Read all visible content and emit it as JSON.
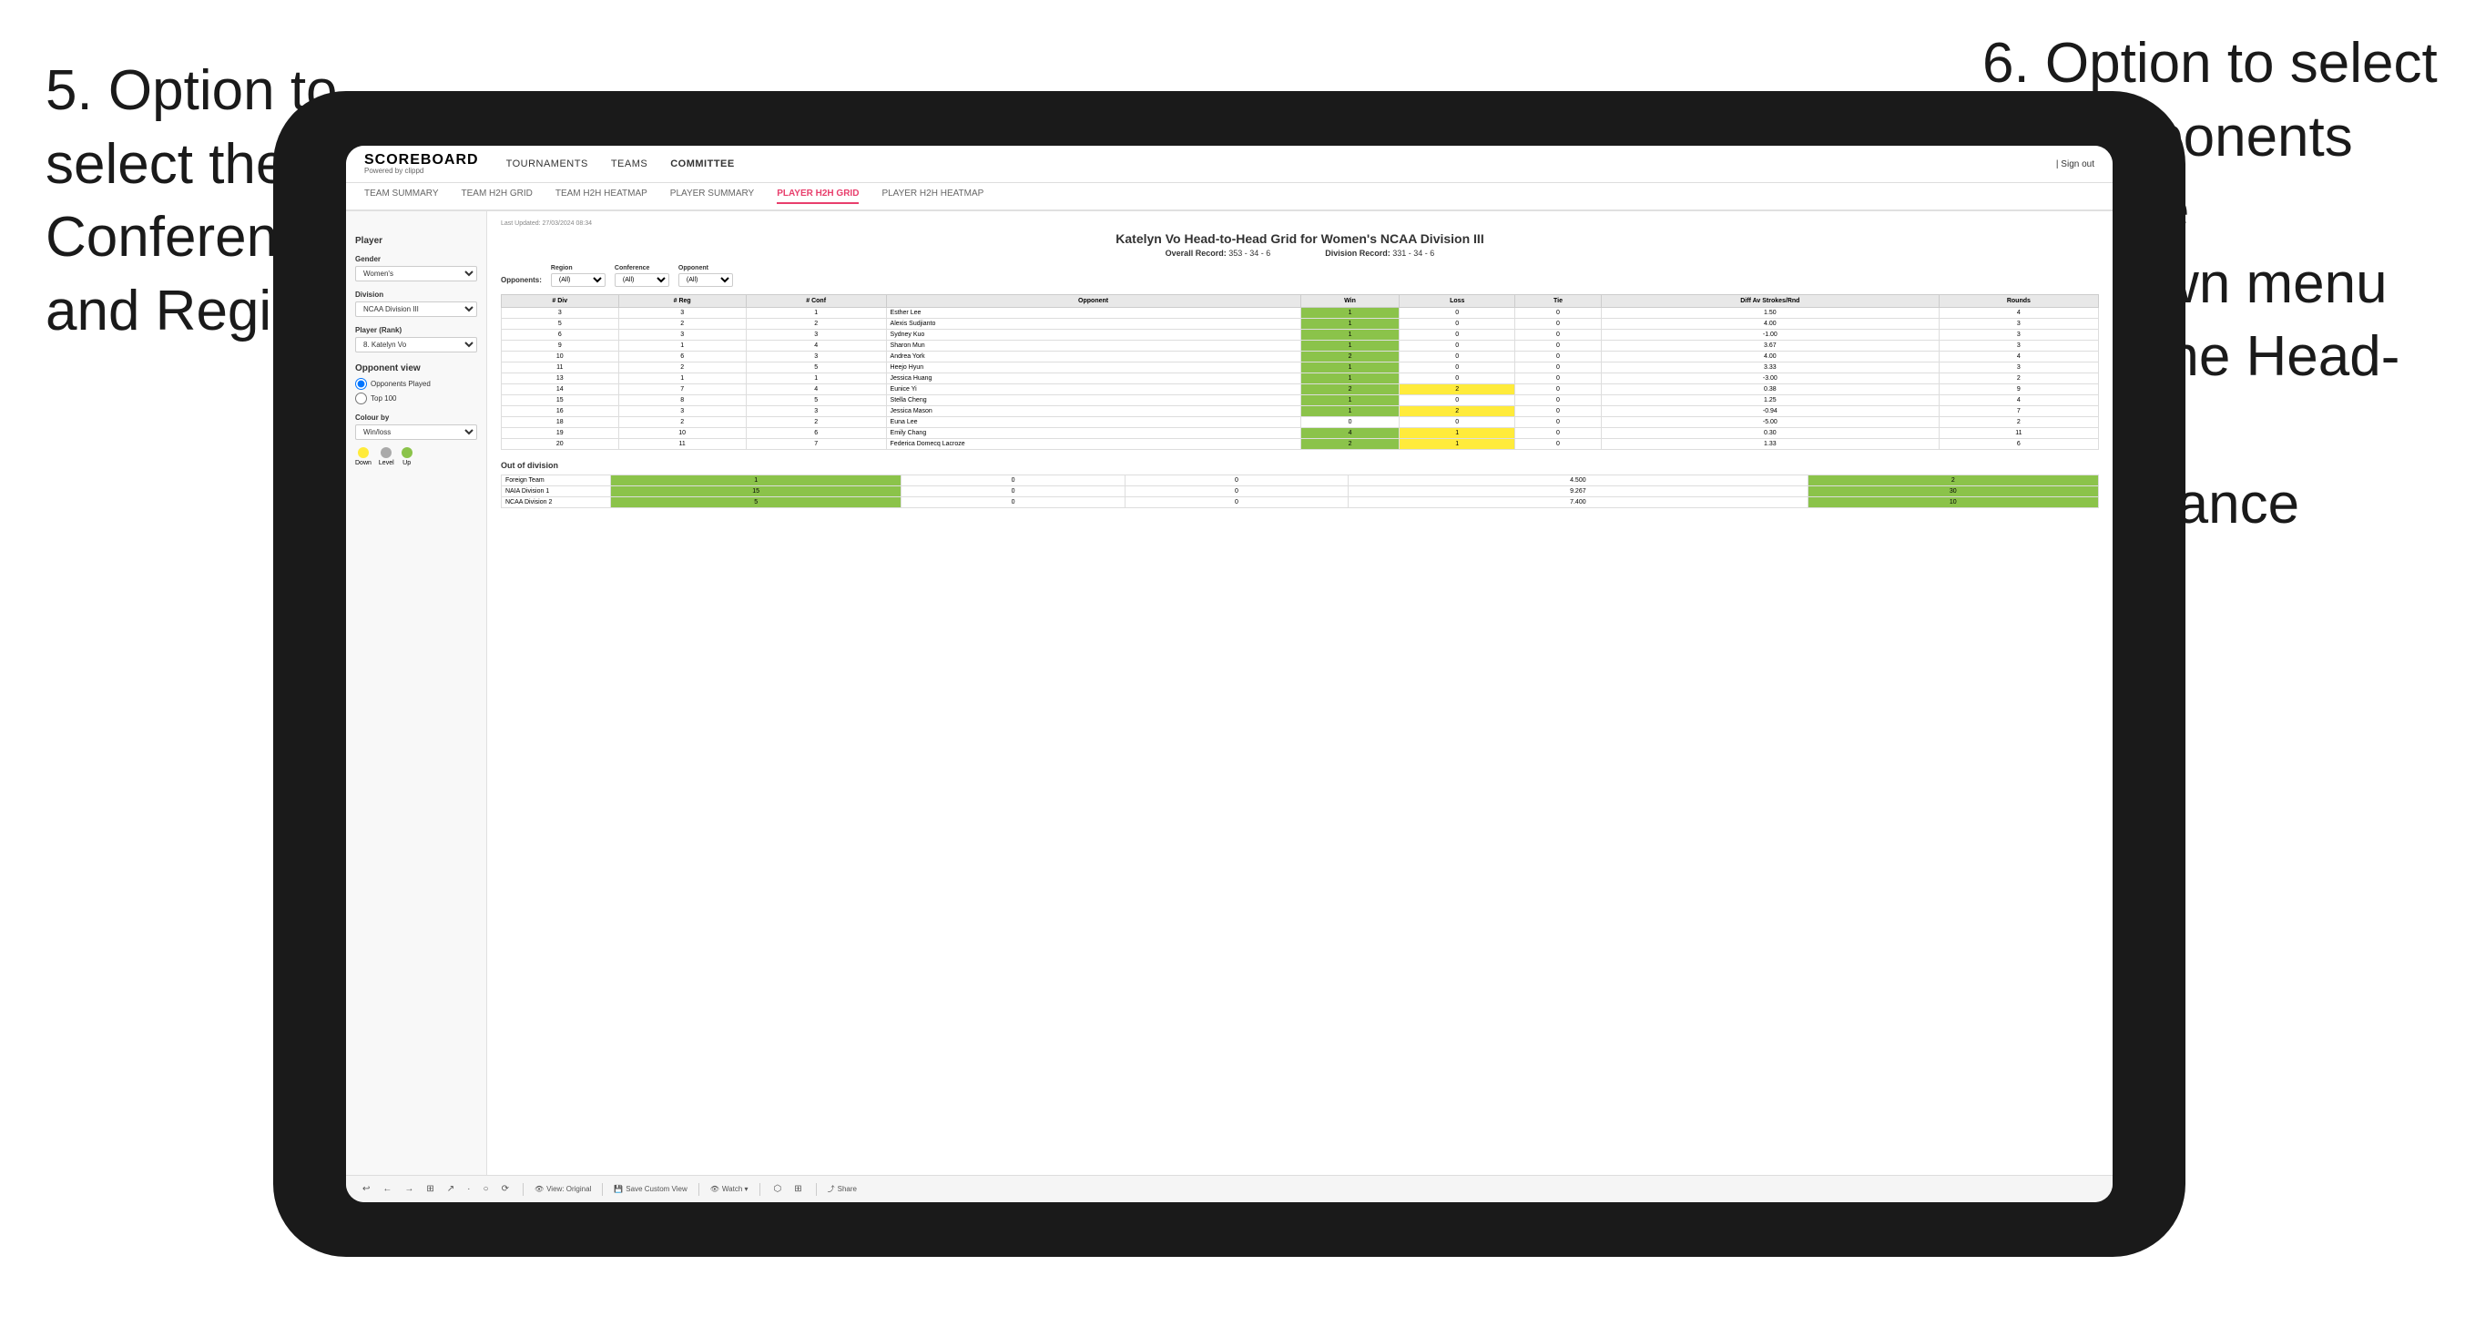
{
  "annotations": {
    "left_title": "5. Option to select the Conference and Region",
    "right_title": "6. Option to select the Opponents from the dropdown menu to see the Head-to-Head performance"
  },
  "app": {
    "logo": {
      "title": "SCOREBOARD",
      "subtitle": "Powered by clippd"
    },
    "nav": {
      "links": [
        "TOURNAMENTS",
        "TEAMS",
        "COMMITTEE"
      ],
      "sign_out": "Sign out"
    },
    "sub_nav": {
      "links": [
        "TEAM SUMMARY",
        "TEAM H2H GRID",
        "TEAM H2H HEATMAP",
        "PLAYER SUMMARY",
        "PLAYER H2H GRID",
        "PLAYER H2H HEATMAP"
      ]
    },
    "sidebar": {
      "player_label": "Player",
      "gender_label": "Gender",
      "gender_value": "Women's",
      "division_label": "Division",
      "division_value": "NCAA Division III",
      "player_rank_label": "Player (Rank)",
      "player_rank_value": "8. Katelyn Vo",
      "opponent_view_label": "Opponent view",
      "opponent_options": [
        "Opponents Played",
        "Top 100"
      ],
      "colour_by_label": "Colour by",
      "colour_by_value": "Win/loss",
      "legend": {
        "down": "Down",
        "level": "Level",
        "up": "Up"
      }
    },
    "grid": {
      "last_updated": "Last Updated: 27/03/2024 08:34",
      "title": "Katelyn Vo Head-to-Head Grid for Women's NCAA Division III",
      "overall_record_label": "Overall Record:",
      "overall_record_value": "353 - 34 - 6",
      "division_record_label": "Division Record:",
      "division_record_value": "331 - 34 - 6",
      "filters": {
        "opponents_label": "Opponents:",
        "region_label": "Region",
        "region_value": "(All)",
        "conference_label": "Conference",
        "conference_value": "(All)",
        "opponent_label": "Opponent",
        "opponent_value": "(All)"
      },
      "table_headers": [
        "# Div",
        "# Reg",
        "# Conf",
        "Opponent",
        "Win",
        "Loss",
        "Tie",
        "Diff Av Strokes/Rnd",
        "Rounds"
      ],
      "rows": [
        {
          "div": "3",
          "reg": "3",
          "conf": "1",
          "opponent": "Esther Lee",
          "win": "1",
          "loss": "0",
          "tie": "0",
          "diff": "1.50",
          "rounds": "4",
          "color": "win"
        },
        {
          "div": "5",
          "reg": "2",
          "conf": "2",
          "opponent": "Alexis Sudjianto",
          "win": "1",
          "loss": "0",
          "tie": "0",
          "diff": "4.00",
          "rounds": "3",
          "color": "win"
        },
        {
          "div": "6",
          "reg": "3",
          "conf": "3",
          "opponent": "Sydney Kuo",
          "win": "1",
          "loss": "0",
          "tie": "0",
          "diff": "-1.00",
          "rounds": "3",
          "color": "neutral"
        },
        {
          "div": "9",
          "reg": "1",
          "conf": "4",
          "opponent": "Sharon Mun",
          "win": "1",
          "loss": "0",
          "tie": "0",
          "diff": "3.67",
          "rounds": "3",
          "color": "win"
        },
        {
          "div": "10",
          "reg": "6",
          "conf": "3",
          "opponent": "Andrea York",
          "win": "2",
          "loss": "0",
          "tie": "0",
          "diff": "4.00",
          "rounds": "4",
          "color": "win"
        },
        {
          "div": "11",
          "reg": "2",
          "conf": "5",
          "opponent": "Heejo Hyun",
          "win": "1",
          "loss": "0",
          "tie": "0",
          "diff": "3.33",
          "rounds": "3",
          "color": "win"
        },
        {
          "div": "13",
          "reg": "1",
          "conf": "1",
          "opponent": "Jessica Huang",
          "win": "1",
          "loss": "0",
          "tie": "0",
          "diff": "-3.00",
          "rounds": "2",
          "color": "neutral"
        },
        {
          "div": "14",
          "reg": "7",
          "conf": "4",
          "opponent": "Eunice Yi",
          "win": "2",
          "loss": "2",
          "tie": "0",
          "diff": "0.38",
          "rounds": "9",
          "color": "loss"
        },
        {
          "div": "15",
          "reg": "8",
          "conf": "5",
          "opponent": "Stella Cheng",
          "win": "1",
          "loss": "0",
          "tie": "0",
          "diff": "1.25",
          "rounds": "4",
          "color": "win"
        },
        {
          "div": "16",
          "reg": "3",
          "conf": "3",
          "opponent": "Jessica Mason",
          "win": "1",
          "loss": "2",
          "tie": "0",
          "diff": "-0.94",
          "rounds": "7",
          "color": "neutral"
        },
        {
          "div": "18",
          "reg": "2",
          "conf": "2",
          "opponent": "Euna Lee",
          "win": "0",
          "loss": "0",
          "tie": "0",
          "diff": "-5.00",
          "rounds": "2",
          "color": "neutral"
        },
        {
          "div": "19",
          "reg": "10",
          "conf": "6",
          "opponent": "Emily Chang",
          "win": "4",
          "loss": "1",
          "tie": "0",
          "diff": "0.30",
          "rounds": "11",
          "color": "win"
        },
        {
          "div": "20",
          "reg": "11",
          "conf": "7",
          "opponent": "Federica Domecq Lacroze",
          "win": "2",
          "loss": "1",
          "tie": "0",
          "diff": "1.33",
          "rounds": "6",
          "color": "win"
        }
      ],
      "out_of_division_label": "Out of division",
      "out_of_division_rows": [
        {
          "opponent": "Foreign Team",
          "win": "1",
          "loss": "0",
          "tie": "0",
          "diff": "4.500",
          "rounds": "2",
          "color": "win"
        },
        {
          "opponent": "NAIA Division 1",
          "win": "15",
          "loss": "0",
          "tie": "0",
          "diff": "9.267",
          "rounds": "30",
          "color": "win"
        },
        {
          "opponent": "NCAA Division 2",
          "win": "5",
          "loss": "0",
          "tie": "0",
          "diff": "7.400",
          "rounds": "10",
          "color": "win"
        }
      ]
    },
    "toolbar": {
      "items": [
        "↩",
        "←",
        "→",
        "⊞",
        "↗",
        "·",
        "○",
        "⟳",
        "View: Original",
        "Save Custom View",
        "Watch ▾",
        "⬡",
        "⊞",
        "Share"
      ]
    }
  }
}
